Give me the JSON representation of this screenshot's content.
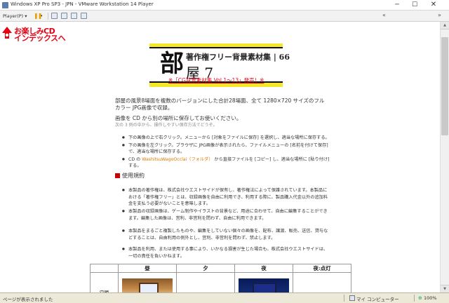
{
  "window": {
    "title": "Windows XP Pro SP3 - JPN - VMware Workstation 14 Player",
    "min_label": "─",
    "max_label": "☐",
    "close_label": "✕"
  },
  "toolbar": {
    "player_label": "Player(P) ▾",
    "pause_label": "❚❚",
    "pause_arrow": "▾",
    "back_arrows": "«",
    "right_icon": "»"
  },
  "logo": {
    "line1": "お楽しみCD",
    "line2": "インデックスへ"
  },
  "banner": {
    "subtitle": "著作権フリー背景素材集 | 66",
    "big_char": "部",
    "room_title": "屋 7"
  },
  "announcement": "※「CG背景素材集 Vol.1〜13」発売！※",
  "intro": {
    "p1": "部屋の風景8場面を複数のバージョンにした合計28場面、全て 1280×720 サイズのフルカラー JPG画像で収録。",
    "p2": "画像を CD から別の場所に保存してお使いください。",
    "p2_sub": "次の 3 例の中から、操作しやすい保存方法でどうぞ。"
  },
  "save_methods": [
    "下の画像の上で右クリック。メニューから [対象をファイルに保存] を選択し、適当な場所に保存する。",
    "下の画像を左クリック。ブラウザに JPG画像が表示されたら、ファイルメニューの [名前を付けて保存] で、適当な場所に保存する。",
    "CD の ",
    "WashitsuWagoOcclai（フォルダ）",
    " から直接ファイルを [コピー] し、適当な場所に [貼り付け] する。"
  ],
  "section": {
    "title": "使用規約"
  },
  "rules": [
    "本製品の著作権は、株式会社ウエストサイドが保有し、著作権法によって保護されています。本製品における「著作権フリー」とは、収録画像を自由に利用でき、利用する際に、製品購入代金以外の追加料金を支払う必要がないことを意味します。",
    "本製品の収録画像は、ゲーム制作やイラストの背景など、用途に合わせて、自由に編集することができます。編集した画像は、営利、非営利を問わず、自由に利用できます。",
    "本製品をまるごと複製したものや、編集をしていない個々の画像を、配布、譲渡、販売、送信、貸与などすることは、自由利用の例外とし、営利、非営利を問わず、禁止します。",
    "本製品を利用、または使用する事により、いかなる損害が生じた場合も、株式会社ウエストサイドは、一切の責任を負いかねます。"
  ],
  "table": {
    "headers": [
      "昼",
      "夕",
      "夜",
      "夜:点灯"
    ],
    "row_label": "空間"
  },
  "status": {
    "text": "ページが表示されました",
    "zone": "マイ コンピューター",
    "zoom": "100%"
  }
}
